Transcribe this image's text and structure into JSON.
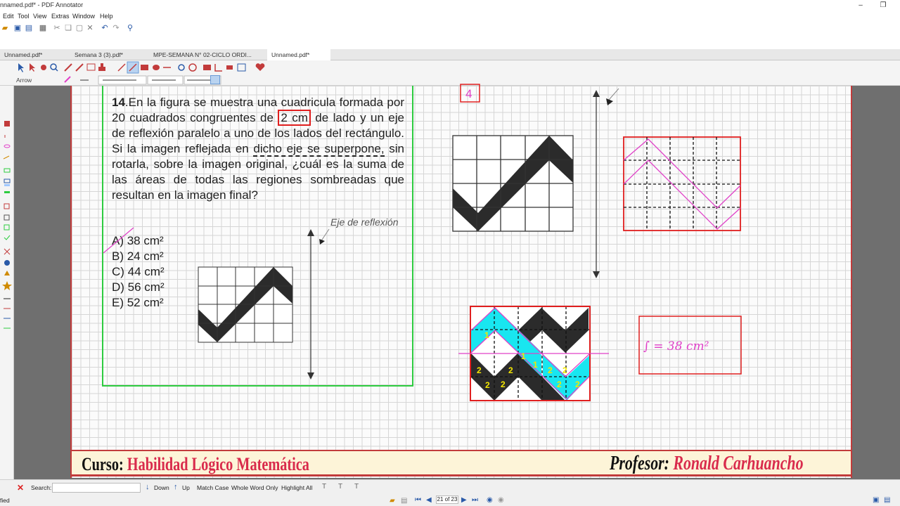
{
  "window": {
    "title": "nnamed.pdf* - PDF Annotator",
    "minimize": "–",
    "restore": "❐"
  },
  "menu": [
    "Edit",
    "Tool",
    "View",
    "Extras",
    "Window",
    "Help"
  ],
  "tabs": [
    {
      "label": "Unnamed.pdf*",
      "active": false
    },
    {
      "label": "Semana 3 (3).pdf*",
      "active": false
    },
    {
      "label": "MPE-SEMANA N° 02-CICLO ORDI...",
      "active": false
    },
    {
      "label": "Unnamed.pdf*",
      "active": true
    }
  ],
  "toolbar3": {
    "tool_label": "Arrow"
  },
  "problem": {
    "number": "14",
    "text_pre": ".En la figura se muestra una cuadricula formada por 20 cuadrados congruentes de ",
    "boxed": "2 cm",
    "text_mid": " de lado y un eje de reflexión paralelo a uno de los lados del rectángulo. Si la imagen reflejada en ",
    "underlined": "dicho eje se superpone,",
    "text_post": " sin rotarla, sobre la imagen original, ¿cuál es la suma de las áreas de todas las regiones sombreadas que resultan en la imagen final?",
    "axis_label": "Eje de reflexión",
    "options": [
      "A) 38 cm²",
      "B) 24 cm²",
      "C) 44 cm²",
      "D) 56 cm²",
      "E) 52 cm²"
    ]
  },
  "annotations": {
    "corner_label": "4",
    "answer": "∫ = 38 cm²",
    "region_numbers": [
      "1",
      "1",
      "1",
      "2",
      "2",
      "2",
      "2",
      "2",
      "2",
      "2",
      "2"
    ]
  },
  "footer": {
    "curso_label": "Curso:",
    "curso_value": "Habilidad Lógico Matemática",
    "profesor_label": "Profesor:",
    "profesor_value": "Ronald Carhuancho"
  },
  "statusbar": {
    "left_text": "fied",
    "search_label": "Search:",
    "search_value": "",
    "down": "Down",
    "up": "Up",
    "match_case": "Match Case",
    "whole_word": "Whole Word Only",
    "highlight_all": "Highlight All",
    "page_indicator": "21 of 23"
  },
  "colors": {
    "accent_red": "#c23b3b",
    "problem_border": "#2ecc40",
    "pink_annotation": "#e040c8",
    "cyan_fill": "#19e6f0",
    "band_bg": "#fdf4d8"
  }
}
